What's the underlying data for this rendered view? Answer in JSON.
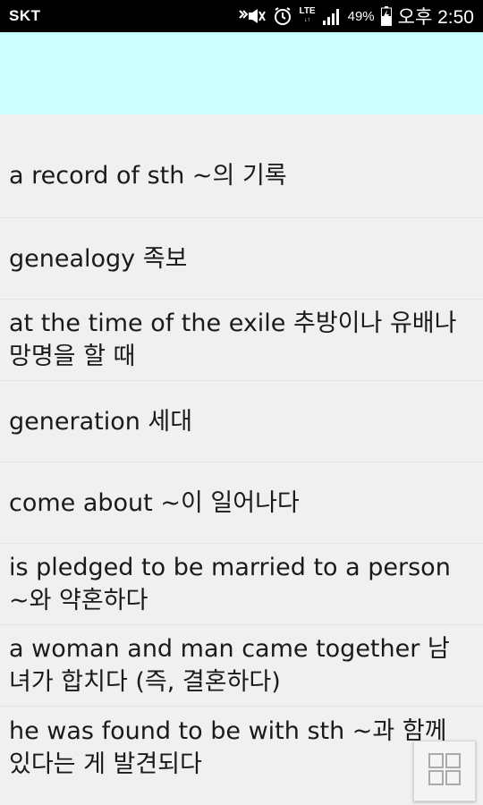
{
  "status_bar": {
    "carrier": "SKT",
    "lte_label": "LTE",
    "battery": "49%",
    "time": "오후 2:50",
    "icons": [
      "mute-icon",
      "alarm-icon",
      "lte-signal-icon",
      "battery-charging-icon"
    ]
  },
  "banner": {
    "color": "#ccffff"
  },
  "items": [
    {
      "text": "a record of sth ~의 기록"
    },
    {
      "text": "genealogy 족보"
    },
    {
      "text": "at the time of the exile 추방이나 유배나 망명을 할 때"
    },
    {
      "text": "generation 세대"
    },
    {
      "text": "come about ~이 일어나다"
    },
    {
      "text": "is pledged to be married to a person ~와 약혼하다"
    },
    {
      "text": "a woman and man came together 남녀가 합치다 (즉, 결혼하다)"
    },
    {
      "text": "he was found to be with sth ~과 함께 있다는 게 발견되다"
    }
  ],
  "fab": {
    "icon": "grid-icon"
  }
}
